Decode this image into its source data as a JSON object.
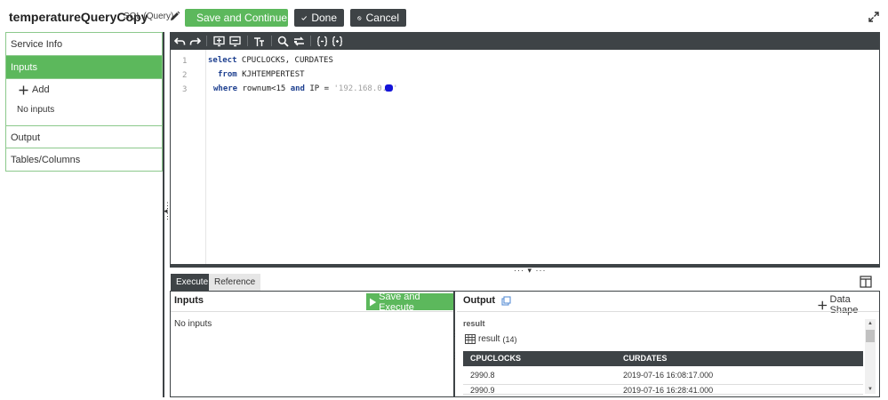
{
  "header": {
    "service_name": "temperatureQueryCopy",
    "service_type": "SQL (Query)",
    "save_continue_label": "Save and Continue",
    "done_label": "Done",
    "cancel_label": "Cancel"
  },
  "left_panel": {
    "items": [
      {
        "label": "Service Info"
      },
      {
        "label": "Inputs"
      },
      {
        "label": "Output"
      },
      {
        "label": "Tables/Columns"
      }
    ],
    "add_label": "Add",
    "no_inputs": "No inputs"
  },
  "editor": {
    "line_numbers": [
      "1",
      "2",
      "3"
    ],
    "lines": [
      {
        "kw1": "select",
        "text1": " CPUCLOCKS, CURDATES"
      },
      {
        "kw1": "from",
        "text1": " KJHTEMPERTEST"
      },
      {
        "kw1": "where",
        "text1": " rownum<15 ",
        "kw2": "and",
        "text2": " IP = ",
        "str": "'192.168.0.",
        "str_end": "'"
      }
    ]
  },
  "bottom_tabs": {
    "execute": "Execute",
    "reference": "Reference"
  },
  "inputs_pane": {
    "title": "Inputs",
    "save_execute_label": "Save and Execute",
    "no_inputs": "No inputs"
  },
  "output_pane": {
    "title": "Output",
    "data_shape_label": "Data Shape",
    "result_label": "result",
    "result_name": "result",
    "result_count": "(14)",
    "columns": [
      "CPUCLOCKS",
      "CURDATES"
    ],
    "rows": [
      [
        "2990.8",
        "2019-07-16 16:08:17.000"
      ],
      [
        "2990.9",
        "2019-07-16 16:28:41.000"
      ]
    ]
  },
  "colors": {
    "accent_green": "#5cb85c",
    "dark_toolbar": "#3e4346"
  }
}
